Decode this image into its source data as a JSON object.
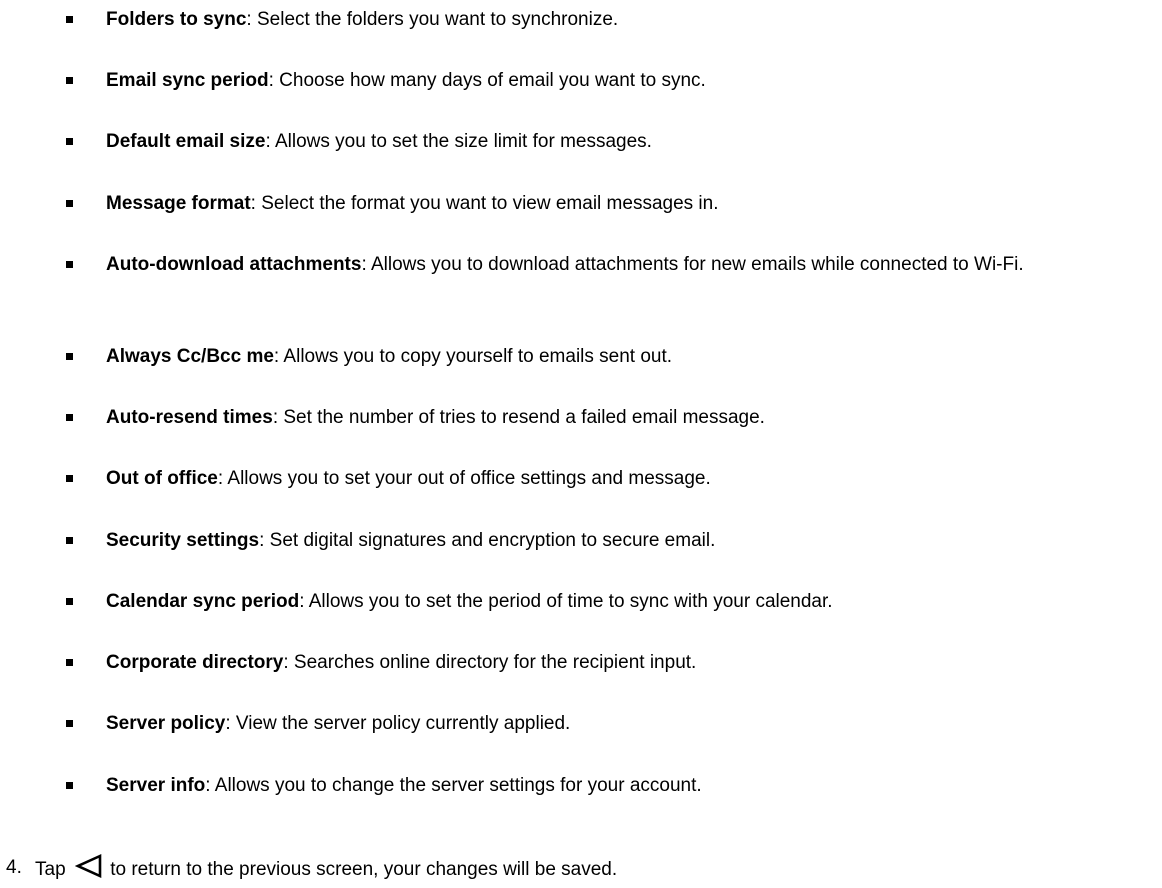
{
  "items": [
    {
      "term": "Folders to sync",
      "desc": ": Select the folders you want to synchronize."
    },
    {
      "term": "Email sync period",
      "desc": ": Choose how many days of email you want to sync."
    },
    {
      "term": "Default email size",
      "desc": ": Allows you to set the size limit for messages."
    },
    {
      "term": "Message format",
      "desc": ": Select the format you want to view email messages in."
    },
    {
      "term": "Auto-download attachments",
      "desc": ": Allows you to download attachments for new emails while connected to Wi-Fi."
    },
    {
      "term": "Always Cc/Bcc me",
      "desc": ": Allows you to copy yourself to emails sent out."
    },
    {
      "term": "Auto-resend times",
      "desc": ": Set the number of tries to resend a failed email message."
    },
    {
      "term": "Out of office",
      "desc": ": Allows you to set your out of office settings and message."
    },
    {
      "term": "Security settings",
      "desc": ": Set digital signatures and encryption to secure email."
    },
    {
      "term": "Calendar sync period",
      "desc": ": Allows you to set the period of time to sync with your calendar."
    },
    {
      "term": "Corporate directory",
      "desc": ": Searches online directory for the recipient input."
    },
    {
      "term": "Server policy",
      "desc": ": View the server policy currently applied."
    },
    {
      "term": "Server info",
      "desc": ": Allows you to change the server settings for your account."
    }
  ],
  "step": {
    "number": "4.",
    "before_icon": "Tap",
    "icon": "back-triangle-icon",
    "after_icon": "to return to the previous screen, your changes will be saved."
  }
}
